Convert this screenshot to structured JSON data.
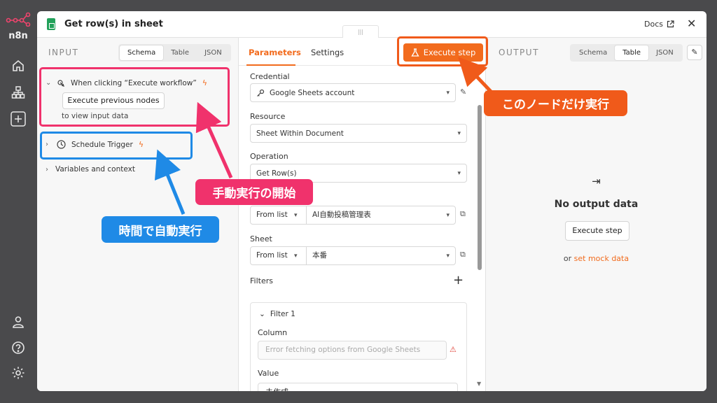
{
  "rail": {
    "logo_text": "n8n",
    "top_icons": [
      "home-icon",
      "workflow-icon",
      "plus-icon"
    ],
    "bottom_icons": [
      "user-icon",
      "help-icon",
      "settings-icon"
    ]
  },
  "header": {
    "title": "Get row(s) in sheet",
    "docs_label": "Docs",
    "close_icon": "close-icon",
    "drag_handle": "|||"
  },
  "input": {
    "section_label": "INPUT",
    "view_tabs": [
      "Schema",
      "Table",
      "JSON"
    ],
    "active_view": "Schema",
    "nodes": [
      {
        "label": "When clicking “Execute workflow”",
        "icon": "pointer-icon"
      },
      {
        "label": "Schedule Trigger",
        "icon": "clock-icon"
      }
    ],
    "execute_previous_label": "Execute previous nodes",
    "hint": "to view input data",
    "variables_label": "Variables and context"
  },
  "params": {
    "tabs": [
      "Parameters",
      "Settings"
    ],
    "active_tab": "Parameters",
    "execute_step_label": "Execute step",
    "credential": {
      "label": "Credential",
      "value": "Google Sheets account"
    },
    "resource": {
      "label": "Resource",
      "value": "Sheet Within Document"
    },
    "operation": {
      "label": "Operation",
      "value": "Get Row(s)"
    },
    "document": {
      "mode": "From list",
      "value": "AI自動投稿管理表"
    },
    "sheet": {
      "label": "Sheet",
      "mode": "From list",
      "value": "本番"
    },
    "filters": {
      "label": "Filters",
      "add_icon": "plus-icon",
      "filter_name": "Filter 1",
      "column_label": "Column",
      "column_placeholder": "Error fetching options from Google Sheets",
      "value_label": "Value",
      "value": "未作成"
    }
  },
  "output": {
    "section_label": "OUTPUT",
    "view_tabs": [
      "Schema",
      "Table",
      "JSON"
    ],
    "active_view": "Table",
    "empty_title": "No output data",
    "execute_step_label": "Execute step",
    "or_text": "or",
    "mock_link": "set mock data"
  },
  "annotations": {
    "execute_only_node": "このノードだけ実行",
    "manual_start": "手動実行の開始",
    "scheduled_auto": "時間で自動実行"
  },
  "colors": {
    "accent": "#f26b1d",
    "annotation_orange": "#f05a1a",
    "annotation_pink": "#f0326c",
    "annotation_blue": "#1f8ae6",
    "sheets_green": "#22a15a"
  }
}
